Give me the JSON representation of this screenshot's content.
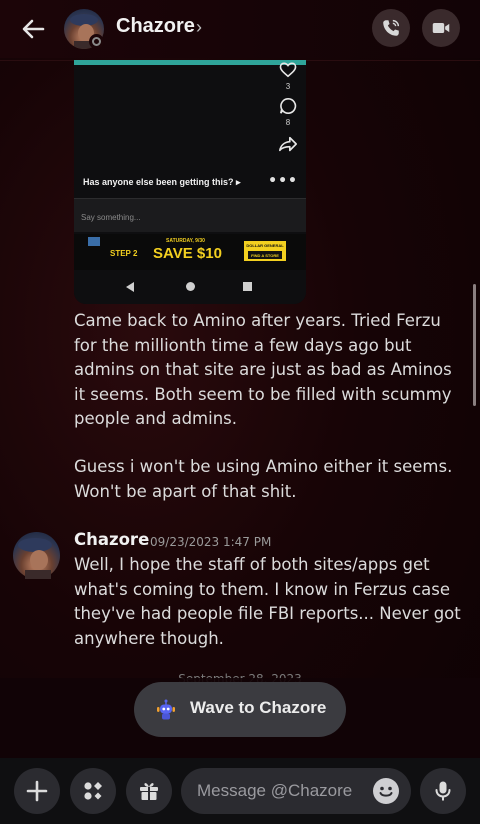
{
  "header": {
    "title": "Chazore",
    "chevron": "›"
  },
  "embed": {
    "likes": "3",
    "comments": "8",
    "caption": "Has anyone else been getting this? ▸",
    "input_placeholder": "Say something...",
    "ad": {
      "step": "STEP 2",
      "date": "SATURDAY, 9/30",
      "save": "SAVE $10",
      "store_line1": "DOLLAR GENERAL",
      "store_line2": "FIND A STORE"
    }
  },
  "messages": [
    {
      "paragraph1": "Came back to Amino after years. Tried Ferzu for the millionth time a few days ago but admins on that site are just as bad as Aminos it seems. Both seem to be filled with scummy people and admins.",
      "paragraph2": "Guess i won't be using Amino either it seems. Won't be apart of that shit."
    },
    {
      "author": "Chazore",
      "timestamp": "09/23/2023 1:47 PM",
      "text": "Well, I hope the staff of both sites/apps get what's coming to them. I know in Ferzus case they've had people file FBI reports... Never got anywhere though."
    }
  ],
  "date_separator": "September 28, 2023",
  "wave_button": {
    "label": "Wave to Chazore"
  },
  "composer": {
    "placeholder": "Message @Chazore"
  },
  "colors": {
    "background": "#170406",
    "accent_bar": "#2fa59a",
    "button_bg": "#2b2b30"
  },
  "icons": {
    "back": "arrow-left-icon",
    "call": "phone-icon",
    "video": "video-camera-icon",
    "plus": "plus-icon",
    "apps": "apps-icon",
    "gift": "gift-icon",
    "emoji": "emoji-icon",
    "mic": "microphone-icon"
  }
}
